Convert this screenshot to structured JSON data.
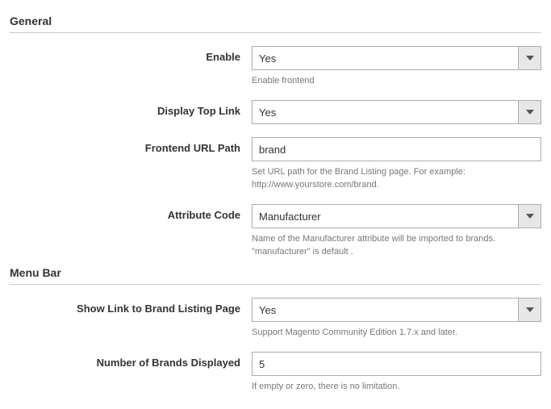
{
  "sections": {
    "general": {
      "title": "General",
      "enable": {
        "label": "Enable",
        "value": "Yes",
        "help": "Enable frontend"
      },
      "display_top_link": {
        "label": "Display Top Link",
        "value": "Yes"
      },
      "frontend_url_path": {
        "label": "Frontend URL Path",
        "value": "brand",
        "help": "Set URL path for the Brand Listing page. For example: http://www.yourstore.com/brand."
      },
      "attribute_code": {
        "label": "Attribute Code",
        "value": "Manufacturer",
        "help": "Name of the Manufacturer attribute will be imported to brands. \"manufacturer\" is default ."
      }
    },
    "menubar": {
      "title": "Menu Bar",
      "show_link": {
        "label": "Show Link to Brand Listing Page",
        "value": "Yes",
        "help": "Support Magento Community Edition 1.7.x and later."
      },
      "num_brands": {
        "label": "Number of Brands Displayed",
        "value": "5",
        "help": "If empty or zero, there is no limitation."
      }
    }
  }
}
